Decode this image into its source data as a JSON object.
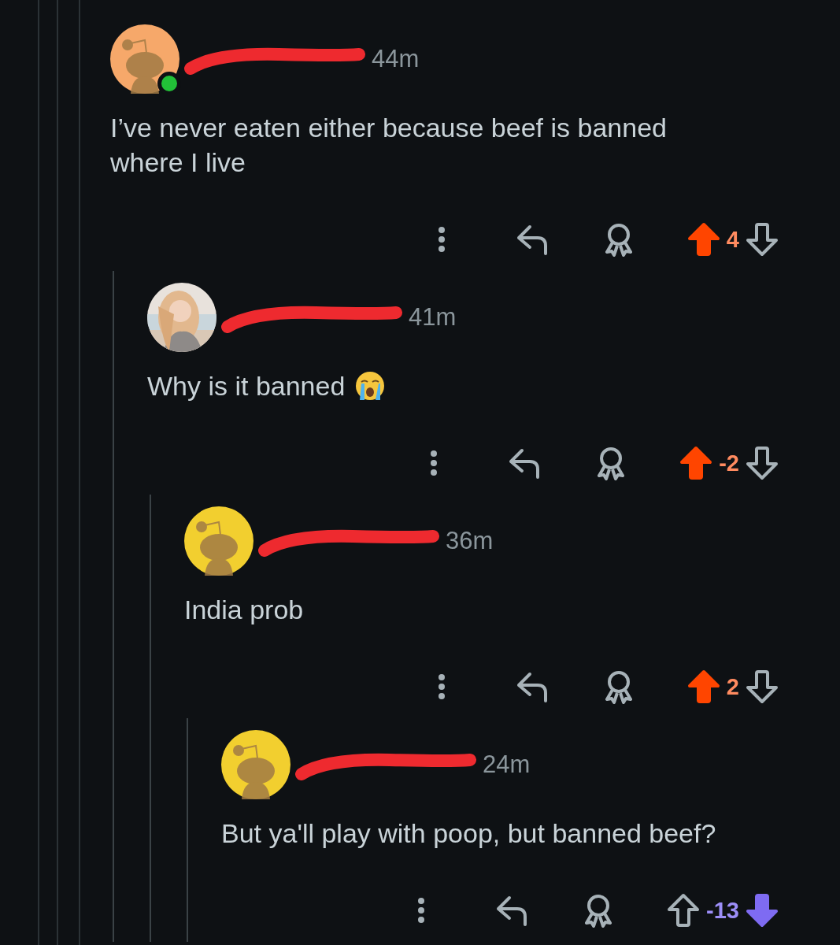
{
  "comments": [
    {
      "avatar": {
        "kind": "snoo",
        "color": "#f6a86a",
        "online": true
      },
      "time": "44m",
      "body": "I’ve never eaten either because beef is banned where I live",
      "upvoted": true,
      "downvoted": false,
      "score": "4",
      "replies": [
        {
          "time": "41m",
          "body": "Why is it banned",
          "crying_emoji": true,
          "upvoted": true,
          "downvoted": false,
          "score": "-2",
          "replies": [
            {
              "avatar": {
                "kind": "snoo",
                "color": "#f2cf2f",
                "online": false
              },
              "time": "36m",
              "body": "India prob",
              "upvoted": true,
              "downvoted": false,
              "score": "2",
              "replies": [
                {
                  "avatar": {
                    "kind": "snoo",
                    "color": "#f2cf2f",
                    "online": false
                  },
                  "time": "24m",
                  "body": "But ya'll play with poop, but banned beef?",
                  "upvoted": false,
                  "downvoted": true,
                  "score": "-13"
                }
              ]
            }
          ]
        }
      ]
    }
  ]
}
